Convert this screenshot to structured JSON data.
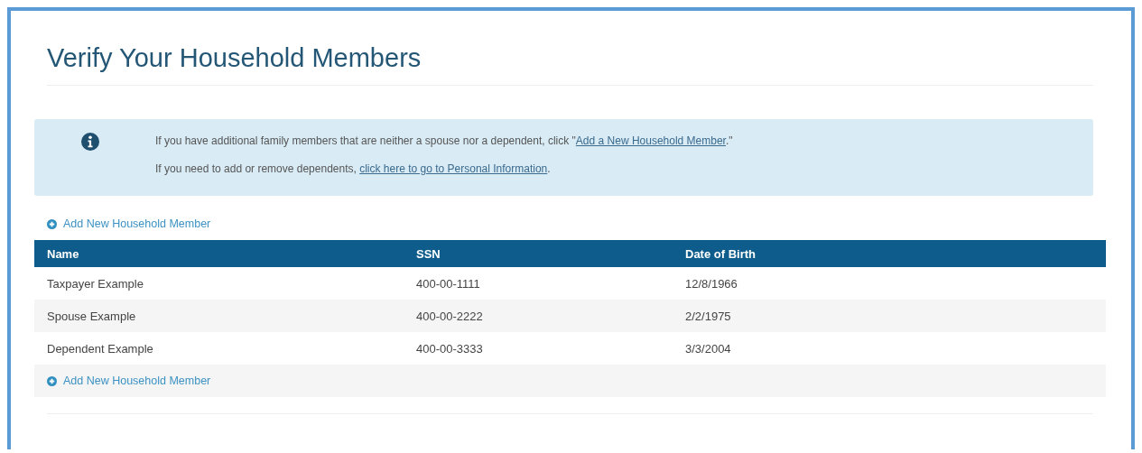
{
  "title": "Verify Your Household Members",
  "info": {
    "lines": [
      {
        "before": "If you have additional family members that are neither a spouse nor a dependent, click \"",
        "link": "Add a New Household Member",
        "after": ".\""
      },
      {
        "before": "If you need to add or remove dependents, ",
        "link": "click here to go to Personal Information",
        "after": "."
      }
    ]
  },
  "add_link_top": "Add New Household Member",
  "table": {
    "columns": [
      "Name",
      "SSN",
      "Date of Birth"
    ],
    "rows": [
      [
        "Taxpayer Example",
        "400-00-1111",
        "12/8/1966"
      ],
      [
        "Spouse Example",
        "400-00-2222",
        "2/2/1975"
      ],
      [
        "Dependent Example",
        "400-00-3333",
        "3/3/2004"
      ]
    ]
  },
  "add_link_bottom": "Add New Household Member"
}
